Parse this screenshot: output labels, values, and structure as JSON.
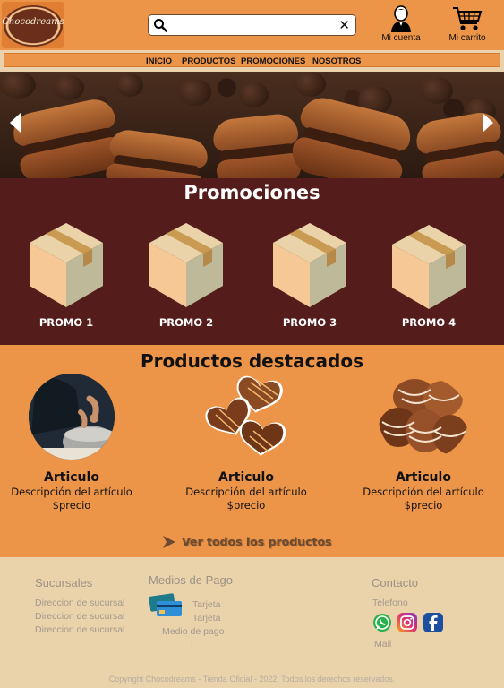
{
  "header": {
    "logo_text": "Chocodreams",
    "search": {
      "value": "",
      "placeholder": ""
    },
    "account_label": "Mi cuenta",
    "cart_label": "Mi carrito"
  },
  "nav": {
    "items": [
      "INICIO",
      "PRODUCTOS",
      "PROMOCIONES",
      "NOSOTROS"
    ]
  },
  "promotions": {
    "title": "Promociones",
    "items": [
      "PROMO 1",
      "PROMO 2",
      "PROMO 3",
      "PROMO 4"
    ]
  },
  "products": {
    "title": "Productos destacados",
    "items": [
      {
        "name": "Articulo",
        "description": "Descripción del artículo",
        "price": "$precio"
      },
      {
        "name": "Articulo",
        "description": "Descripción del artículo",
        "price": "$precio"
      },
      {
        "name": "Articulo",
        "description": "Descripción del artículo",
        "price": "$precio"
      }
    ],
    "see_all": "Ver todos los productos"
  },
  "footer": {
    "branches": {
      "title": "Sucursales",
      "lines": [
        "Direccion de sucursal",
        "Direccion de sucursal",
        "Direccion de sucursal"
      ]
    },
    "payment": {
      "title": "Medios de Pago",
      "lines": [
        "Tarjeta",
        "Tarjeta",
        "Medio de pago",
        "|"
      ]
    },
    "contact": {
      "title": "Contacto",
      "phone": "Telefono",
      "mail": "Mail"
    },
    "copyright": "Copyright Chocodreams - Tienda Oficial - 2022. Todos los derechos reservados."
  },
  "colors": {
    "header_bg": "#ec9447",
    "promo_bg": "#541c1a",
    "footer_bg": "#ead2ab"
  }
}
